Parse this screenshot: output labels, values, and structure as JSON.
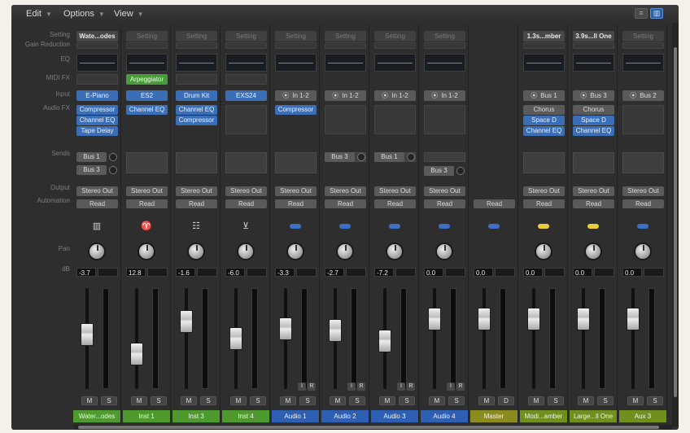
{
  "menubar": {
    "edit": "Edit",
    "options": "Options",
    "view": "View"
  },
  "row_labels": {
    "setting": "Setting",
    "gain_reduction": "Gain Reduction",
    "eq": "EQ",
    "midi_fx": "MIDI FX",
    "input": "Input",
    "audio_fx": "Audio FX",
    "sends": "Sends",
    "output": "Output",
    "automation": "Automation",
    "pan": "Pan",
    "db": "dB"
  },
  "colors": {
    "instrument": "#4e9a2e",
    "audio": "#2f5fb3",
    "master": "#8b8b1f",
    "aux": "#6f8f1f"
  },
  "channels": [
    {
      "name": "Water...odes",
      "type": "instrument",
      "setting": "Wate...odes",
      "midi_fx": "",
      "input": "E-Piano",
      "input_icon": "",
      "audio_fx": [
        "Compressor",
        "Channel EQ",
        "Tape Delay"
      ],
      "sends": [
        "Bus 1",
        "Bus 3"
      ],
      "output": "Stereo Out",
      "automation": "Read",
      "icon": "keyboard-icon",
      "db": "-3.7",
      "fader_level": 0.55,
      "extra": [
        "M",
        "S"
      ]
    },
    {
      "name": "Inst 1",
      "type": "instrument",
      "setting": "Setting",
      "midi_fx": "Arpeggiator",
      "input": "ES2",
      "input_icon": "",
      "audio_fx": [
        "Channel EQ"
      ],
      "sends": [],
      "output": "Stereo Out",
      "automation": "Read",
      "icon": "synth-icon",
      "db": "12.8",
      "fader_level": 0.3,
      "extra": [
        "M",
        "S"
      ]
    },
    {
      "name": "Inst 3",
      "type": "instrument",
      "setting": "Setting",
      "midi_fx": "",
      "input": "Drum Kit",
      "input_icon": "",
      "audio_fx": [
        "Channel EQ",
        "Compressor"
      ],
      "sends": [],
      "output": "Stereo Out",
      "automation": "Read",
      "icon": "drum-icon",
      "db": "-1.6",
      "fader_level": 0.72,
      "extra": [
        "M",
        "S"
      ]
    },
    {
      "name": "Inst 4",
      "type": "instrument",
      "setting": "Setting",
      "midi_fx": "",
      "input": "EXS24",
      "input_icon": "",
      "audio_fx": [],
      "sends": [],
      "output": "Stereo Out",
      "automation": "Read",
      "icon": "sampler-icon",
      "db": "-6.0",
      "fader_level": 0.5,
      "extra": [
        "M",
        "S"
      ]
    },
    {
      "name": "Audio 1",
      "type": "audio",
      "setting": "Setting",
      "midi_fx": "",
      "input": "In 1-2",
      "input_icon": "⦿",
      "audio_fx": [
        "Compressor"
      ],
      "sends": [],
      "output": "Stereo Out",
      "automation": "Read",
      "icon": "audio-icon",
      "db": "-3.3",
      "fader_level": 0.62,
      "extra": [
        "M",
        "S"
      ]
    },
    {
      "name": "Audio 2",
      "type": "audio",
      "setting": "Setting",
      "midi_fx": "",
      "input": "In 1-2",
      "input_icon": "⦿",
      "audio_fx": [],
      "sends": [
        "Bus 3"
      ],
      "output": "Stereo Out",
      "automation": "Read",
      "icon": "audio-icon",
      "db": "-2.7",
      "fader_level": 0.6,
      "extra": [
        "M",
        "S"
      ]
    },
    {
      "name": "Audio 3",
      "type": "audio",
      "setting": "Setting",
      "midi_fx": "",
      "input": "In 1-2",
      "input_icon": "⦿",
      "audio_fx": [],
      "sends": [
        "Bus 1"
      ],
      "output": "Stereo Out",
      "automation": "Read",
      "icon": "audio-icon",
      "db": "-7.2",
      "fader_level": 0.47,
      "extra": [
        "M",
        "S"
      ]
    },
    {
      "name": "Audio 4",
      "type": "audio",
      "setting": "Setting",
      "midi_fx": "",
      "input": "In 1-2",
      "input_icon": "⦿",
      "audio_fx": [],
      "sends": [
        "Bus 3"
      ],
      "output": "Stereo Out",
      "automation": "Read",
      "icon": "audio-icon",
      "db": "0.0",
      "fader_level": 0.75,
      "extra": [
        "M",
        "S"
      ]
    },
    {
      "name": "Master",
      "type": "master",
      "setting": "",
      "midi_fx": "",
      "input": "",
      "input_icon": "",
      "audio_fx": [],
      "sends": [],
      "output": "",
      "automation": "Read",
      "icon": "audio-icon",
      "db": "0.0",
      "fader_level": 0.75,
      "extra": [
        "M",
        "D"
      ]
    },
    {
      "name": "Modi...amber",
      "type": "aux",
      "setting": "1.3s...mber",
      "midi_fx": "",
      "input": "Bus 1",
      "input_icon": "⦿",
      "audio_fx": [
        "Chorus",
        "Space D",
        "Channel EQ"
      ],
      "sends": [],
      "output": "Stereo Out",
      "automation": "Read",
      "icon": "aux-icon",
      "db": "0.0",
      "fader_level": 0.75,
      "extra": [
        "M",
        "S"
      ]
    },
    {
      "name": "Large...ll One",
      "type": "aux",
      "setting": "3.9s...ll One",
      "midi_fx": "",
      "input": "Bus 3",
      "input_icon": "⦿",
      "audio_fx": [
        "Chorus",
        "Space D",
        "Channel EQ"
      ],
      "sends": [],
      "output": "Stereo Out",
      "automation": "Read",
      "icon": "aux-icon",
      "db": "0.0",
      "fader_level": 0.75,
      "extra": [
        "M",
        "S"
      ]
    },
    {
      "name": "Aux 3",
      "type": "aux",
      "setting": "Setting",
      "midi_fx": "",
      "input": "Bus 2",
      "input_icon": "⦿",
      "audio_fx": [],
      "sends": [],
      "output": "Stereo Out",
      "automation": "Read",
      "icon": "audio-icon",
      "db": "0.0",
      "fader_level": 0.75,
      "extra": [
        "M",
        "S"
      ]
    }
  ]
}
